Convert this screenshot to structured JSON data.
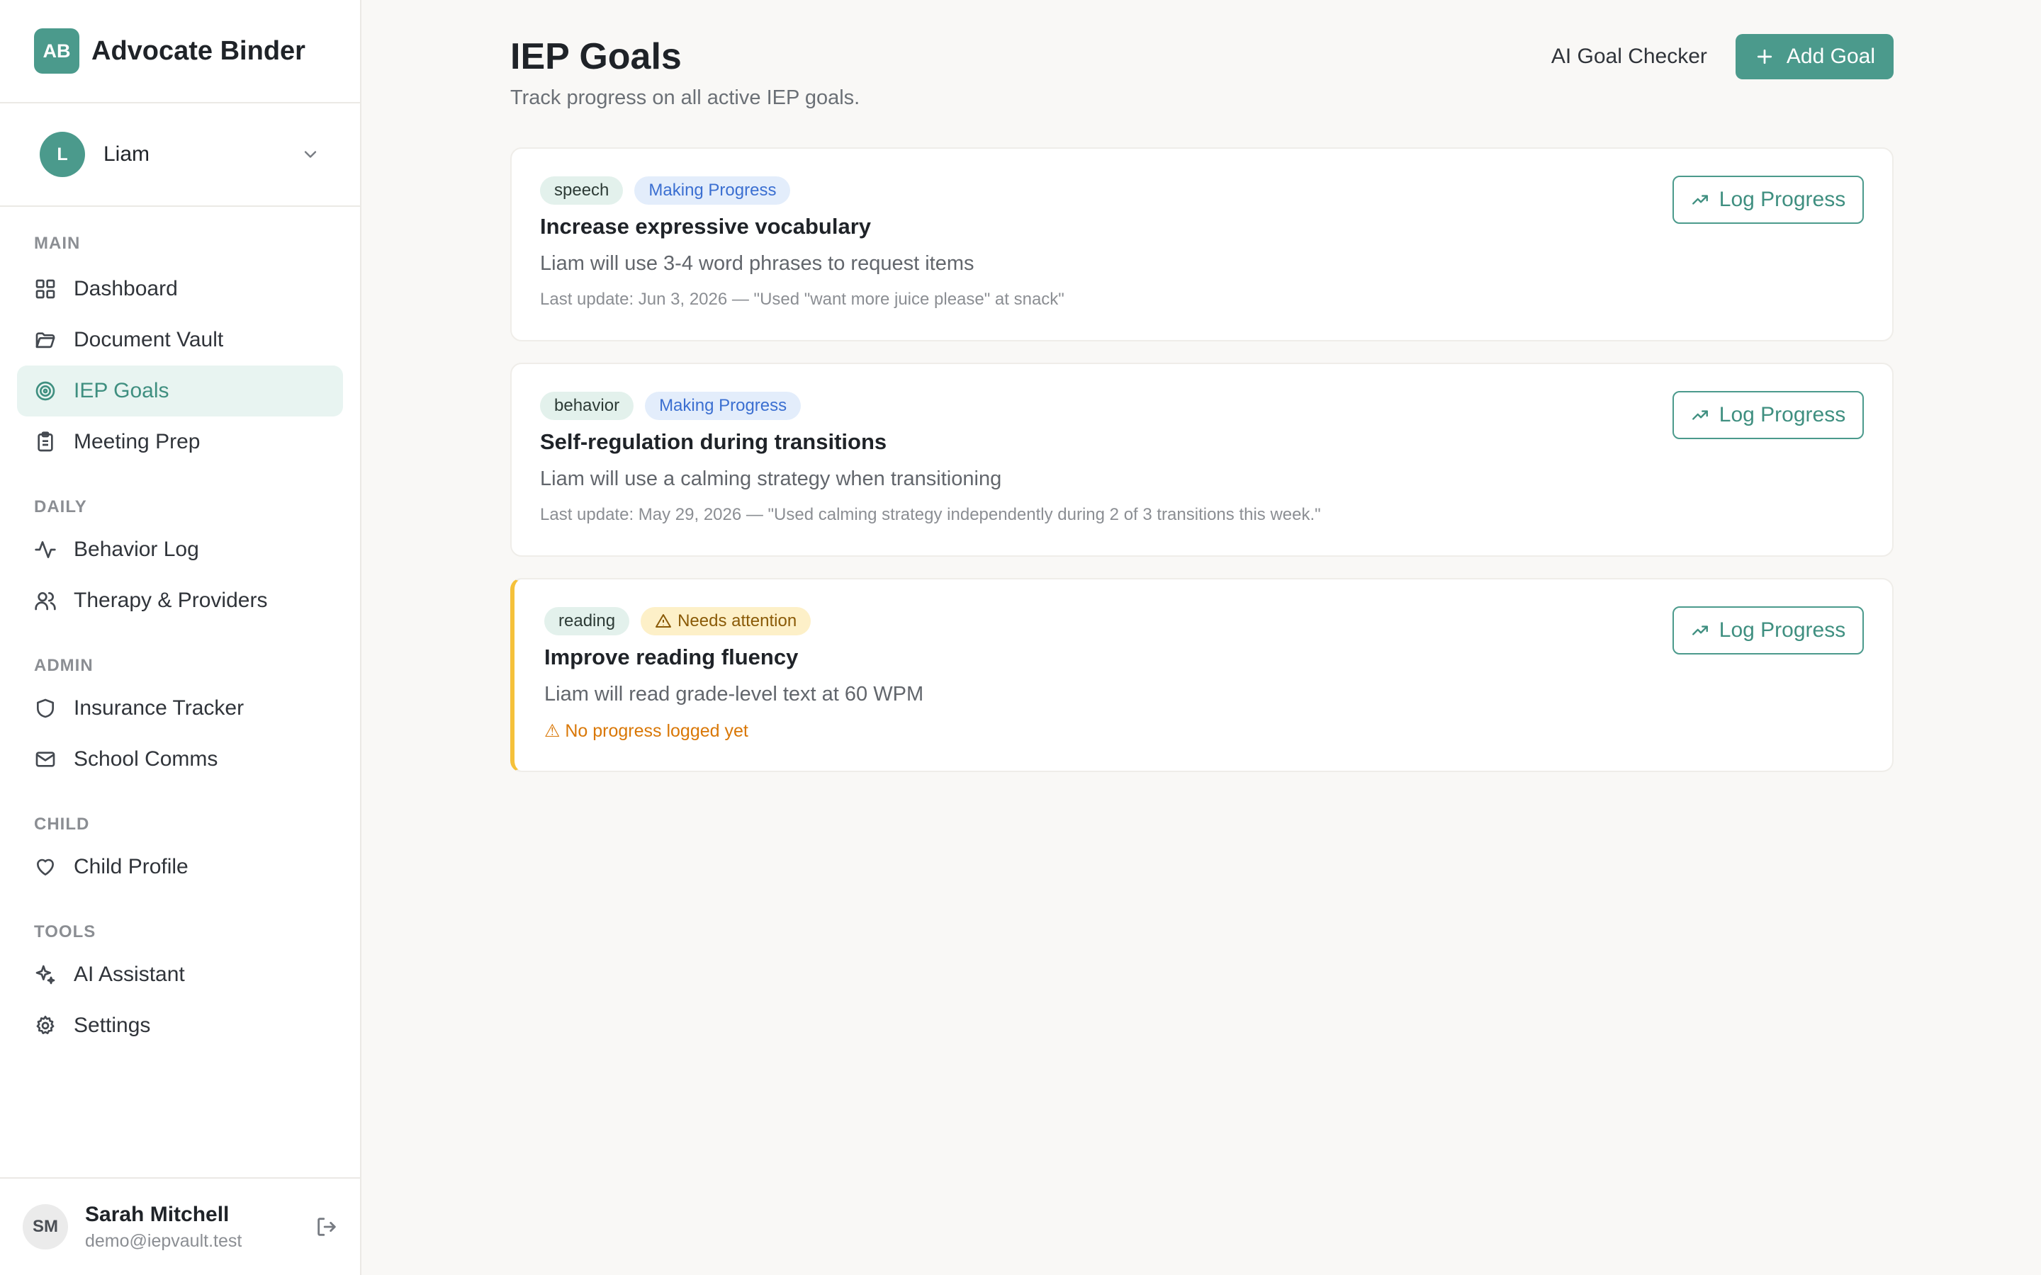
{
  "brand": {
    "logo": "AB",
    "name": "Advocate Binder"
  },
  "child": {
    "initial": "L",
    "name": "Liam"
  },
  "nav": {
    "main_label": "MAIN",
    "daily_label": "DAILY",
    "admin_label": "ADMIN",
    "child_label": "CHILD",
    "tools_label": "TOOLS",
    "dashboard": "Dashboard",
    "document_vault": "Document Vault",
    "iep_goals": "IEP Goals",
    "meeting_prep": "Meeting Prep",
    "behavior_log": "Behavior Log",
    "therapy_providers": "Therapy & Providers",
    "insurance_tracker": "Insurance Tracker",
    "school_comms": "School Comms",
    "child_profile": "Child Profile",
    "ai_assistant": "AI Assistant",
    "settings": "Settings"
  },
  "user": {
    "initials": "SM",
    "name": "Sarah Mitchell",
    "email": "demo@iepvault.test"
  },
  "page": {
    "title": "IEP Goals",
    "subtitle": "Track progress on all active IEP goals.",
    "ai_checker": "AI Goal Checker",
    "add_goal": "Add Goal"
  },
  "goals": [
    {
      "category": "speech",
      "status": "Making Progress",
      "title": "Increase expressive vocabulary",
      "description": "Liam will use 3-4 word phrases to request items",
      "update": "Last update: Jun 3, 2026 — \"Used \"want more juice please\" at snack\"",
      "action": "Log Progress"
    },
    {
      "category": "behavior",
      "status": "Making Progress",
      "title": "Self-regulation during transitions",
      "description": "Liam will use a calming strategy when transitioning",
      "update": "Last update: May 29, 2026 — \"Used calming strategy independently during 2 of 3 transitions this week.\"",
      "action": "Log Progress"
    },
    {
      "category": "reading",
      "status": "Needs attention",
      "title": "Improve reading fluency",
      "description": "Liam will read grade-level text at 60 WPM",
      "warning": "⚠ No progress logged yet",
      "action": "Log Progress"
    }
  ],
  "colors": {
    "accent": "#4b9a8c",
    "active_bg": "#e8f4f1",
    "progress_badge": "#3b6fd1",
    "attention_border": "#f5c13a",
    "warning_text": "#d97706"
  }
}
